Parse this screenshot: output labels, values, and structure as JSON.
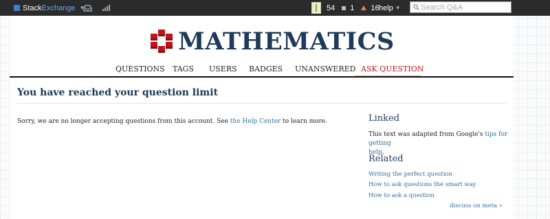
{
  "topbar": {
    "brand_stack": "Stack",
    "brand_exchange": "Exchange",
    "inbox_icon": "inbox-icon",
    "achievements_icon": "achievements-icon",
    "reputation": "54",
    "silver_badges": "1",
    "bronze_badges": "16",
    "help_label": "help",
    "search_placeholder": "Search Q&A"
  },
  "site": {
    "title": "MATHEMATICS"
  },
  "nav": {
    "items": [
      "QUESTIONS",
      "TAGS",
      "USERS",
      "BADGES",
      "UNANSWERED",
      "ASK QUESTION"
    ],
    "active_index": 5,
    "active_color": "#c0141c"
  },
  "main": {
    "heading": "You have reached your question limit",
    "message_before": "Sorry, we are no longer accepting questions from this account. See ",
    "message_link": "the Help Center",
    "message_after": " to learn more."
  },
  "sidebar": {
    "linked_heading": "Linked",
    "linked_text": "This text was adapted from Google's ",
    "linked_link_line1": "tips for getting",
    "linked_link_line2": "help",
    "linked_period": ".",
    "related_heading": "Related",
    "related_links": [
      "Writing the perfect question",
      "How to ask questions the smart way",
      "How to ask a question"
    ],
    "meta_link": "discuss on meta »"
  },
  "colors": {
    "topbar_bg": "#2b2b2b",
    "link": "#2c6e9e",
    "heading": "#173a52",
    "logo_red": "#c0141c"
  }
}
